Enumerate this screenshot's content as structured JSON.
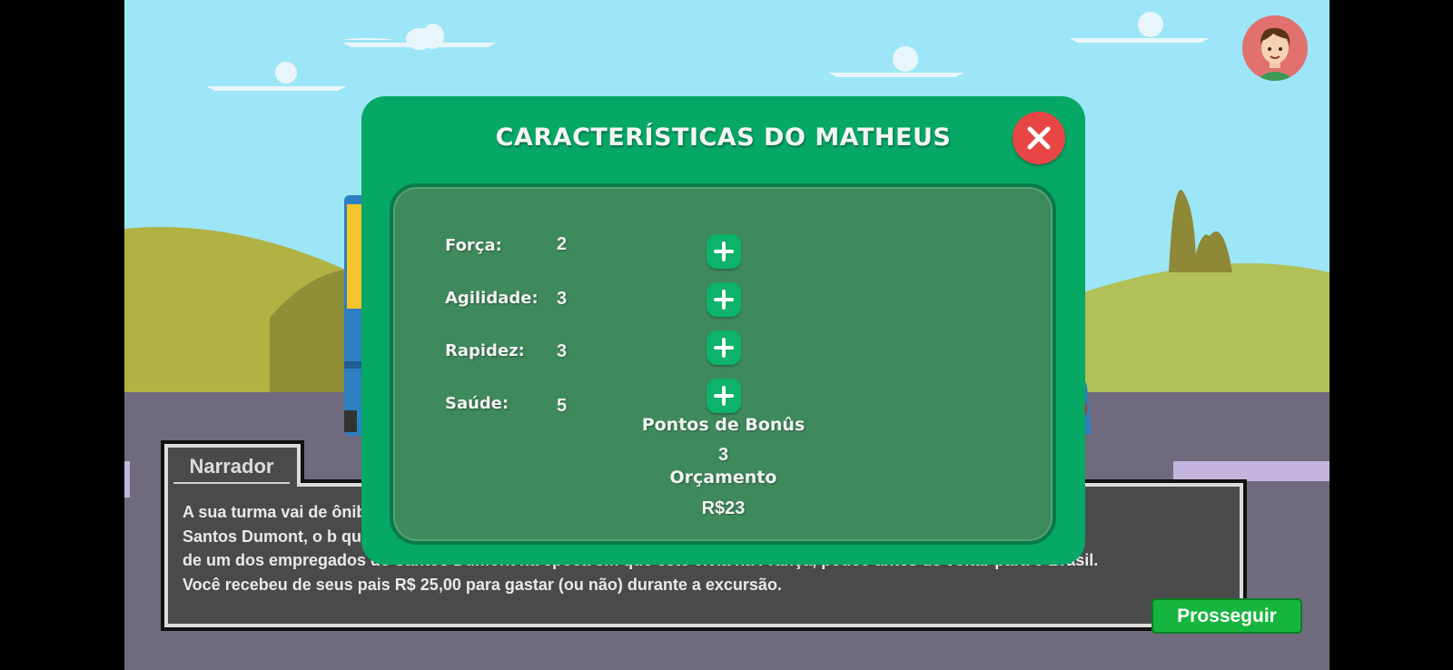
{
  "modal": {
    "title": "CARACTERÍSTICAS DO MATHEUS",
    "stats": [
      {
        "label": "Força:",
        "value": "2"
      },
      {
        "label": "Agilidade:",
        "value": "3"
      },
      {
        "label": "Rapidez:",
        "value": "3"
      },
      {
        "label": "Saúde:",
        "value": "5"
      }
    ],
    "bonus_label": "Pontos de Bonûs",
    "bonus_value": "3",
    "budget_label": "Orçamento",
    "budget_value": "R$23"
  },
  "narrator": {
    "title": "Narrador",
    "lines": [
      "A sua turma vai de ônibus visitar a casa onde viveu o inventor brasileiro Alberto Santos Dumont, o bre Alberto",
      "Santos Dumont, o b                                                                                     que morou o filho",
      "de um dos empregados de Santos Dumont na época em que este vivia na França, pouco antes de voltar para o Brasil.",
      "Você recebeu de seus pais R$ 25,00 para gastar (ou não) durante a excursão."
    ]
  },
  "continue_label": "Prosseguir",
  "colors": {
    "sky": "#9de6f7",
    "modal_green": "#06a865",
    "board_green": "#3f8a5d",
    "close_red": "#e84545",
    "continue_green": "#16b53d",
    "road": "#706a7e"
  },
  "icons": {
    "close": "close-icon",
    "plus": "plus-icon",
    "avatar": "boy-avatar"
  }
}
